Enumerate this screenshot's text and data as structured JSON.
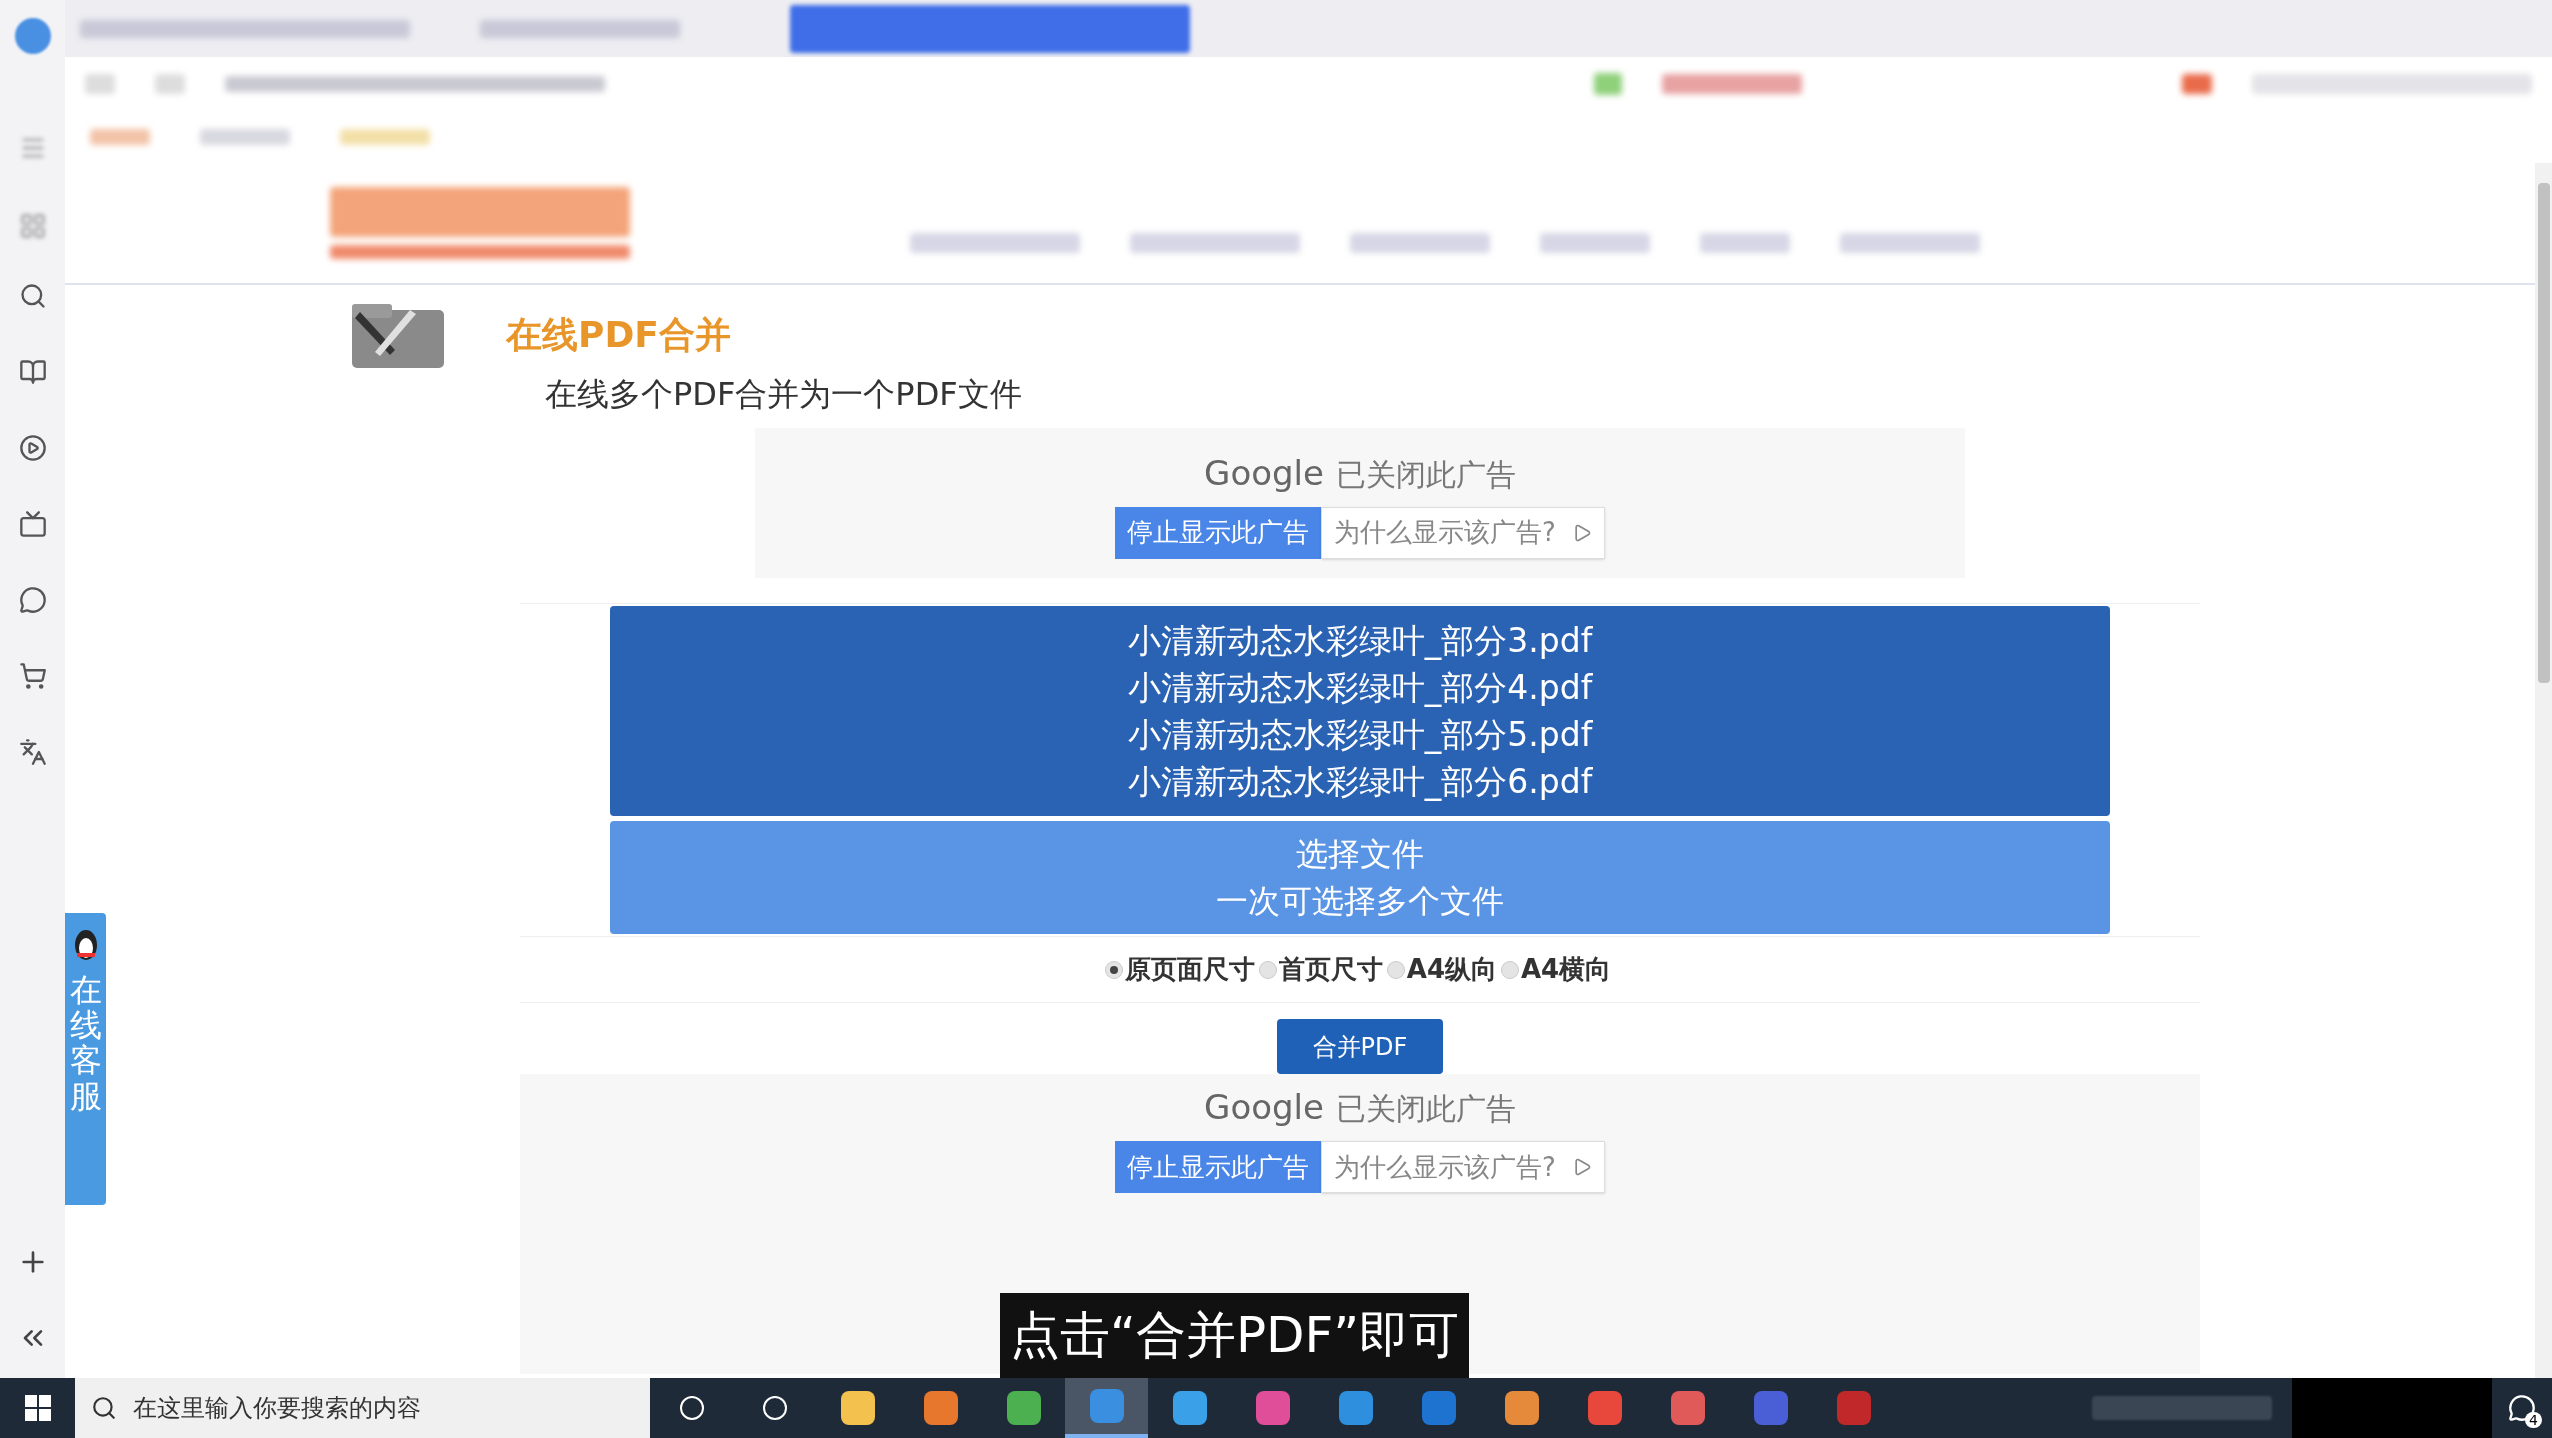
{
  "page": {
    "title": "在线PDF合并",
    "subtitle": "在线多个PDF合并为一个PDF文件"
  },
  "ads": [
    {
      "brand": "Google",
      "notice": "已关闭此广告",
      "stop_button": "停止显示此广告",
      "why_button": "为什么显示该广告?"
    },
    {
      "brand": "Google",
      "notice": "已关闭此广告",
      "stop_button": "停止显示此广告",
      "why_button": "为什么显示该广告?"
    }
  ],
  "selected_files": [
    "小清新动态水彩绿叶_部分3.pdf",
    "小清新动态水彩绿叶_部分4.pdf",
    "小清新动态水彩绿叶_部分5.pdf",
    "小清新动态水彩绿叶_部分6.pdf"
  ],
  "choose_file": {
    "label": "选择文件",
    "hint": "一次可选择多个文件"
  },
  "page_size_options": [
    {
      "label": "原页面尺寸",
      "selected": true
    },
    {
      "label": "首页尺寸",
      "selected": false
    },
    {
      "label": "A4纵向",
      "selected": false
    },
    {
      "label": "A4横向",
      "selected": false
    }
  ],
  "merge_button": "合并PDF",
  "customer_service": "在线客服",
  "caption": "点击“合并PDF”即可",
  "taskbar": {
    "search_placeholder": "在这里输入你要搜索的内容",
    "notification_count": "4",
    "apps": [
      {
        "selected": false
      },
      {
        "selected": false
      },
      {
        "selected": false
      },
      {
        "selected": false
      },
      {
        "selected": false
      },
      {
        "selected": true
      },
      {
        "selected": false
      },
      {
        "selected": false
      },
      {
        "selected": false
      },
      {
        "selected": false
      },
      {
        "selected": false
      },
      {
        "selected": false
      },
      {
        "selected": false
      },
      {
        "selected": false
      },
      {
        "selected": false
      }
    ]
  }
}
